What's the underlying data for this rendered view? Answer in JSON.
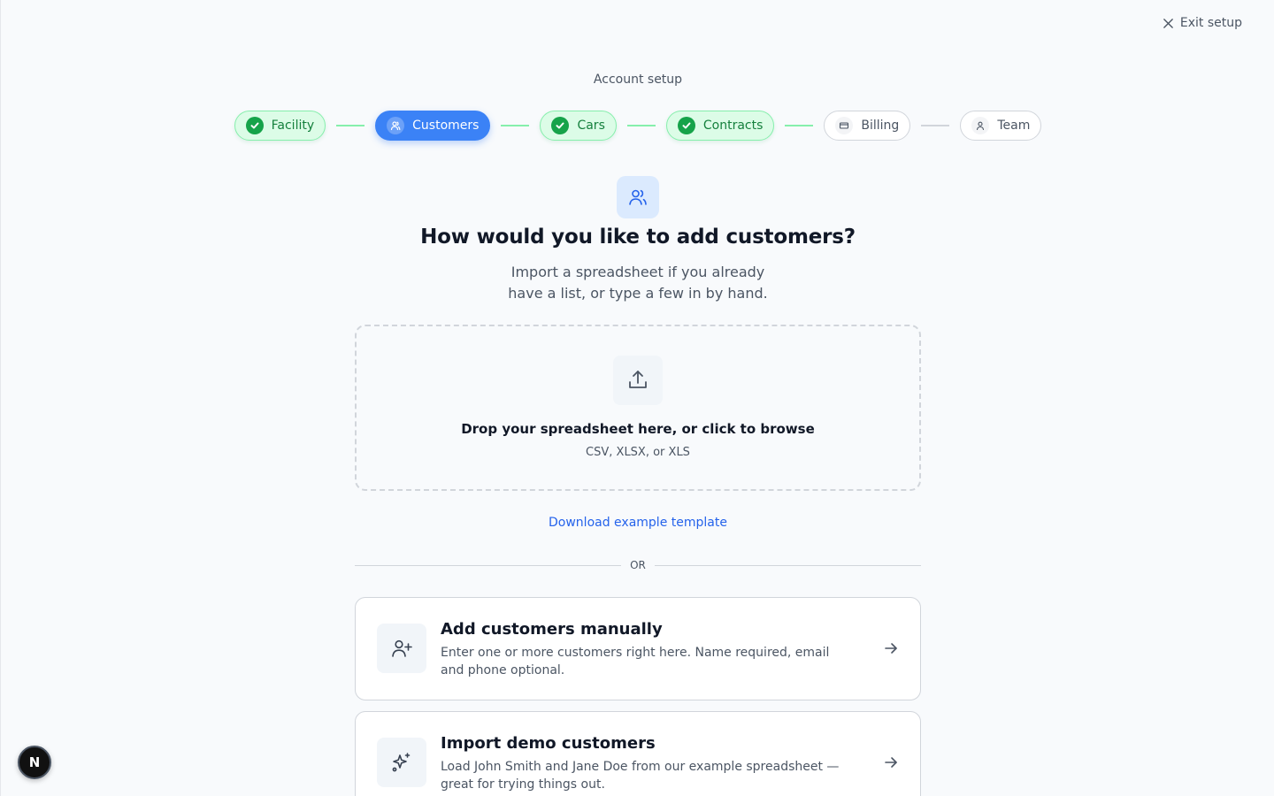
{
  "header": {
    "exit_label": "Exit setup",
    "overline": "Account setup"
  },
  "steps": [
    {
      "label": "Facility",
      "status": "completed",
      "icon": "check-icon"
    },
    {
      "label": "Customers",
      "status": "active",
      "icon": "users-icon"
    },
    {
      "label": "Cars",
      "status": "completed",
      "icon": "check-icon"
    },
    {
      "label": "Contracts",
      "status": "completed",
      "icon": "check-icon"
    },
    {
      "label": "Billing",
      "status": "pending",
      "icon": "credit-card-icon"
    },
    {
      "label": "Team",
      "status": "pending",
      "icon": "user-icon"
    }
  ],
  "main": {
    "heading": "How would you like to add customers?",
    "subheading": "Import a spreadsheet if you already have a list, or type a few in by hand.",
    "hero_icon": "users-icon"
  },
  "dropzone": {
    "icon": "upload-icon",
    "title": "Drop your spreadsheet here, or click to browse",
    "formats": "CSV, XLSX, or XLS"
  },
  "template_link": "Download example template",
  "divider_label": "OR",
  "options": [
    {
      "title": "Add customers manually",
      "description": "Enter one or more customers right here. Name required, email and phone optional.",
      "icon": "user-plus-icon"
    },
    {
      "title": "Import demo customers",
      "description": "Load John Smith and Jane Doe from our example spreadsheet — great for trying things out.",
      "icon": "sparkles-icon"
    }
  ],
  "badge_letter": "N",
  "colors": {
    "accent": "#3b82f6",
    "success": "#16a34a",
    "success_bg": "#dcfce7",
    "link": "#2563eb",
    "background": "#f8fafc"
  }
}
